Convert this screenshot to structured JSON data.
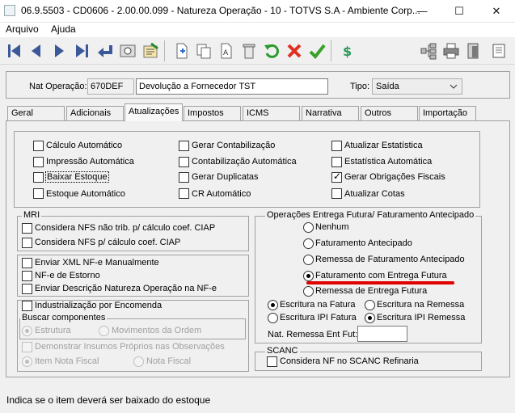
{
  "window": {
    "title": "06.9.5503 - CD0606 - 2.00.00.099 - Natureza Operação - 10 - TOTVS S.A - Ambiente Corp...",
    "minimize": "—",
    "maximize": "☐",
    "close": "✕"
  },
  "menu": {
    "items": [
      "Arquivo",
      "Ajuda"
    ]
  },
  "toolbar": {
    "icons": [
      "first-icon",
      "previous-icon",
      "next-icon",
      "last-icon",
      "go-to-icon",
      "search-icon",
      "list-icon",
      "new-icon",
      "copy-icon",
      "edit-icon",
      "delete-icon",
      "undo-icon",
      "cancel-icon",
      "save-icon",
      "currency-icon",
      "tree-icon",
      "print-icon",
      "exit-icon",
      "scroll-icon"
    ]
  },
  "header": {
    "nat_label": "Nat Operação:",
    "nat_code": "670DEF",
    "nat_desc": "Devolução a Fornecedor TST",
    "tipo_label": "Tipo:",
    "tipo_value": "Saída"
  },
  "tabs": [
    "Geral",
    "Adicionais",
    "Atualizações",
    "Impostos",
    "ICMS",
    "Narrativa",
    "Outros",
    "Importação"
  ],
  "active_tab": "Atualizações",
  "updates": {
    "col1": [
      {
        "label": "Cálculo Automático",
        "checked": false
      },
      {
        "label": "Impressão Automática",
        "checked": false
      },
      {
        "label": "Baixar Estoque",
        "checked": false
      },
      {
        "label": "Estoque Automático",
        "checked": false
      }
    ],
    "col2": [
      {
        "label": "Gerar Contabilização",
        "checked": false
      },
      {
        "label": "Contabilização Automática",
        "checked": false
      },
      {
        "label": "Gerar Duplicatas",
        "checked": false
      },
      {
        "label": "CR Automático",
        "checked": false
      }
    ],
    "col3": [
      {
        "label": "Atualizar Estatística",
        "checked": false
      },
      {
        "label": "Estatística Automática",
        "checked": false
      },
      {
        "label": "Gerar Obrigações Fiscais",
        "checked": true
      },
      {
        "label": "Atualizar Cotas",
        "checked": false
      }
    ]
  },
  "mri": {
    "title": "MRI",
    "items": [
      "Considera NFS não trib. p/ cálculo coef. CIAP",
      "Considera NFS p/ cálculo coef. CIAP"
    ]
  },
  "nfe": {
    "items": [
      "Enviar XML NF-e Manualmente",
      "NF-e de Estorno",
      "Enviar Descrição Natureza Operação na NF-e"
    ]
  },
  "industrializacao": {
    "title": "Industrialização por Encomenda",
    "buscar_title": "Buscar componentes",
    "buscar_options": [
      "Estrutura",
      "Movimentos da Ordem"
    ],
    "demonstrar": "Demonstrar Insumos Próprios nas Observações",
    "item_options": [
      "Item Nota Fiscal",
      "Nota Fiscal"
    ]
  },
  "entrega_futura": {
    "title": "Operações Entrega Futura/ Faturamento Antecipado",
    "options": [
      "Nenhum",
      "Faturamento Antecipado",
      "Remessa de Faturamento Antecipado",
      "Faturamento com Entrega Futura",
      "Remessa de Entrega Futura"
    ],
    "selected": "Faturamento com Entrega Futura",
    "escrituracao": [
      "Escritura na Fatura",
      "Escritura na Remessa",
      "Escritura IPI Fatura",
      "Escritura IPI Remessa"
    ],
    "nat_remessa_label": "Nat. Remessa Ent Fut:",
    "nat_remessa_value": ""
  },
  "scanc": {
    "title": "SCANC",
    "item": "Considera NF no SCANC Refinaria"
  },
  "status": "Indica se o item deverá ser baixado do estoque",
  "colors": {
    "annotation": "#e00000",
    "accent": "#3a7bd5"
  }
}
